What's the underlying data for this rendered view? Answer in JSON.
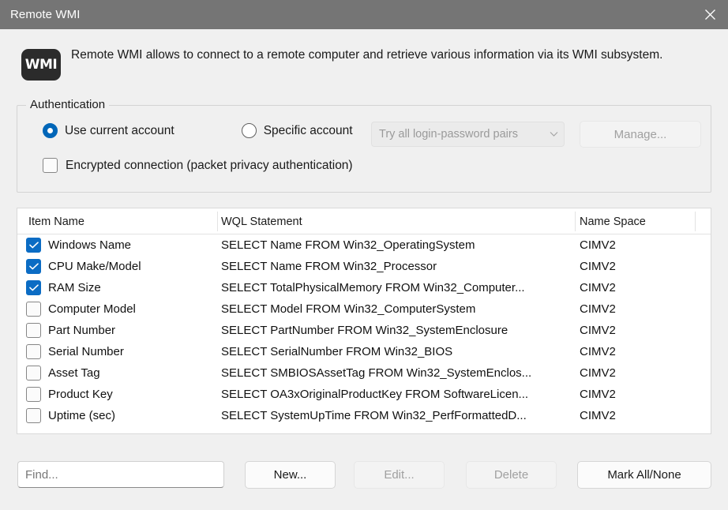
{
  "window": {
    "title": "Remote WMI",
    "close_icon": "close-icon"
  },
  "header": {
    "icon_text": "WMI",
    "description": "Remote WMI allows to connect to a remote computer and retrieve various information via its WMI subsystem."
  },
  "authentication": {
    "legend": "Authentication",
    "radios": [
      {
        "label": "Use current account",
        "checked": true
      },
      {
        "label": "Specific account",
        "checked": false
      }
    ],
    "encrypted_checkbox": {
      "label": "Encrypted connection (packet privacy authentication)",
      "checked": false
    },
    "login_mode_combo": {
      "value": "Try all login-password pairs",
      "disabled": true
    },
    "manage_button": {
      "label": "Manage...",
      "disabled": true
    }
  },
  "table": {
    "columns": [
      "Item Name",
      "WQL Statement",
      "Name Space"
    ],
    "rows": [
      {
        "checked": true,
        "name": "Windows Name",
        "wql": "SELECT Name FROM Win32_OperatingSystem",
        "ns": "CIMV2"
      },
      {
        "checked": true,
        "name": "CPU Make/Model",
        "wql": "SELECT Name FROM Win32_Processor",
        "ns": "CIMV2"
      },
      {
        "checked": true,
        "name": "RAM Size",
        "wql": "SELECT TotalPhysicalMemory FROM Win32_Computer...",
        "ns": "CIMV2"
      },
      {
        "checked": false,
        "name": "Computer Model",
        "wql": "SELECT Model FROM Win32_ComputerSystem",
        "ns": "CIMV2"
      },
      {
        "checked": false,
        "name": "Part Number",
        "wql": "SELECT PartNumber FROM Win32_SystemEnclosure",
        "ns": "CIMV2"
      },
      {
        "checked": false,
        "name": "Serial Number",
        "wql": "SELECT SerialNumber FROM Win32_BIOS",
        "ns": "CIMV2"
      },
      {
        "checked": false,
        "name": "Asset Tag",
        "wql": "SELECT SMBIOSAssetTag FROM Win32_SystemEnclos...",
        "ns": "CIMV2"
      },
      {
        "checked": false,
        "name": "Product Key",
        "wql": "SELECT OA3xOriginalProductKey FROM SoftwareLicen...",
        "ns": "CIMV2"
      },
      {
        "checked": false,
        "name": "Uptime (sec)",
        "wql": "SELECT SystemUpTime FROM Win32_PerfFormattedD...",
        "ns": "CIMV2"
      }
    ]
  },
  "footer": {
    "find_placeholder": "Find...",
    "find_value": "",
    "buttons": [
      {
        "label": "New...",
        "disabled": false
      },
      {
        "label": "Edit...",
        "disabled": true
      },
      {
        "label": "Delete",
        "disabled": true
      },
      {
        "label": "Mark All/None",
        "disabled": false
      }
    ]
  },
  "colors": {
    "titlebar": "#757575",
    "accent": "#0b6cc4",
    "radio_accent": "#0066b8",
    "window_bg": "#f0f0f0",
    "table_bg": "#ffffff"
  }
}
